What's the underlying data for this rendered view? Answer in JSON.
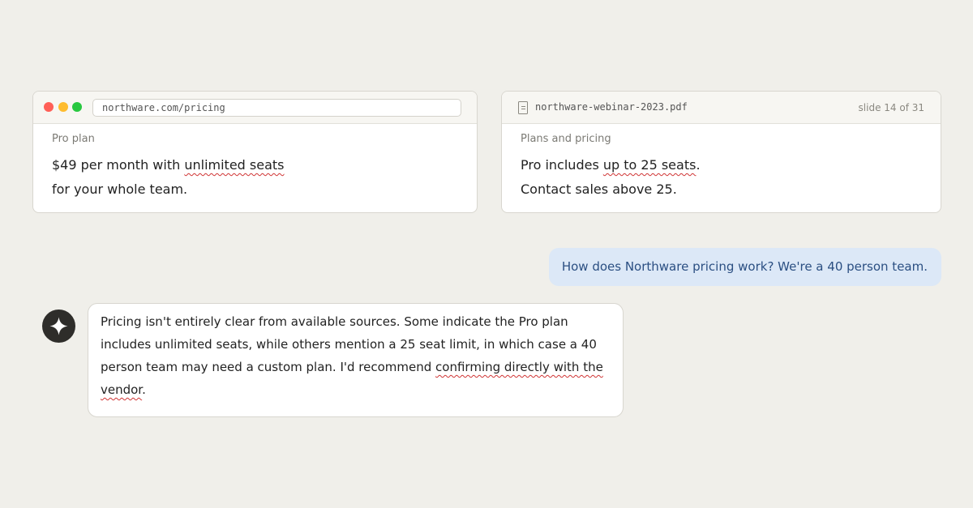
{
  "browser_card": {
    "url": "northware.com/pricing",
    "label": "Pro plan",
    "text_before": "$49 per month with ",
    "text_highlight": "unlimited seats",
    "text_after": "for your whole team."
  },
  "pdf_card": {
    "filename": "northware-webinar-2023.pdf",
    "slide_info": "slide 14 of 31",
    "label": "Plans and pricing",
    "text_before": "Pro includes ",
    "text_highlight": "up to 25 seats",
    "text_after": ".",
    "text_line2": "Contact sales above 25."
  },
  "chat": {
    "user_message": "How does Northware pricing work? We're a 40 person team.",
    "assistant_before": "Pricing isn't entirely clear from available sources. Some indicate the Pro plan includes unlimited seats, while others mention a 25 seat limit, in which case a 40 person team may need a custom plan. I'd recommend ",
    "assistant_highlight": "confirming directly with the vendor",
    "assistant_after": "."
  },
  "colors": {
    "background": "#f0efea",
    "user_bubble": "#dce8f7",
    "user_text": "#2b4f82",
    "squiggle": "#d03434",
    "avatar": "#2e2d2a"
  },
  "icons": {
    "window_controls": [
      "close-dot",
      "minimize-dot",
      "maximize-dot"
    ],
    "pdf": "document-icon",
    "assistant": "sparkle-icon"
  }
}
